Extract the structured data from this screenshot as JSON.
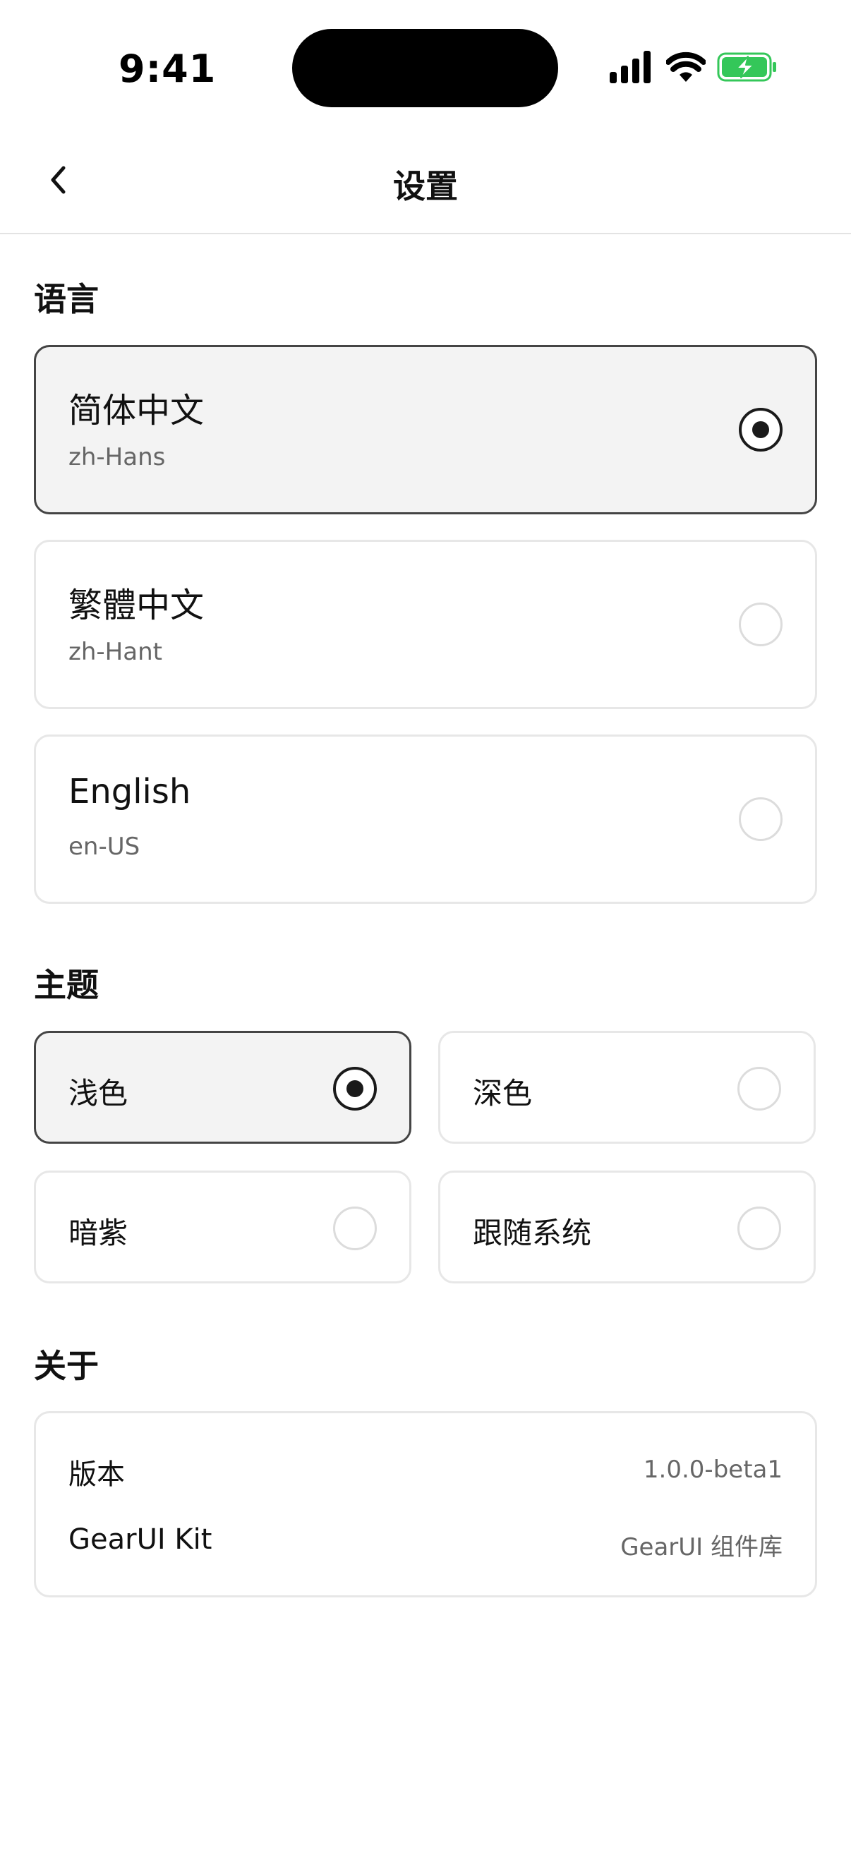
{
  "status_bar": {
    "time": "9:41",
    "icons": [
      "cellular-signal-icon",
      "wifi-icon",
      "battery-charging-icon"
    ],
    "battery_color": "#34c759"
  },
  "header": {
    "title": "设置",
    "back_icon": "chevron-left-icon"
  },
  "language": {
    "title": "语言",
    "options": [
      {
        "name": "简体中文",
        "code": "zh-Hans",
        "selected": true
      },
      {
        "name": "繁體中文",
        "code": "zh-Hant",
        "selected": false
      },
      {
        "name": "English",
        "code": "en-US",
        "selected": false
      }
    ]
  },
  "theme": {
    "title": "主题",
    "options": [
      {
        "label": "浅色",
        "selected": true
      },
      {
        "label": "深色",
        "selected": false
      },
      {
        "label": "暗紫",
        "selected": false
      },
      {
        "label": "跟随系统",
        "selected": false
      }
    ]
  },
  "about": {
    "title": "关于",
    "rows": [
      {
        "key": "版本",
        "value": "1.0.0-beta1"
      },
      {
        "key": "GearUI Kit",
        "value": "GearUI 组件库"
      }
    ]
  },
  "colors": {
    "selected_border": "#444444",
    "selected_bg": "#f3f3f3",
    "card_border": "#e7e7e7",
    "secondary_text": "#666666"
  }
}
